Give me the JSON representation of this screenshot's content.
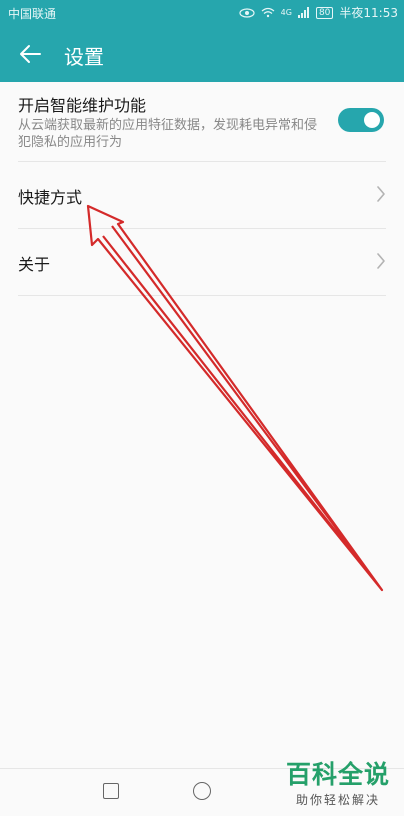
{
  "status_bar": {
    "carrier": "中国联通",
    "signal_type": "4G",
    "battery": "80",
    "time": "半夜11:53"
  },
  "app_bar": {
    "back_icon": "arrow-left-icon",
    "title": "设置"
  },
  "settings": {
    "smart_maintenance": {
      "title": "开启智能维护功能",
      "description": "从云端获取最新的应用特征数据，发现耗电异常和侵犯隐私的应用行为",
      "enabled": true
    },
    "items": [
      {
        "label": "快捷方式",
        "icon": "chevron-right-icon"
      },
      {
        "label": "关于",
        "icon": "chevron-right-icon"
      }
    ]
  },
  "nav_bar": {
    "recent_icon": "square-icon",
    "home_icon": "circle-icon"
  },
  "watermark": {
    "main": "百科全说",
    "sub": "助你轻松解决"
  },
  "colors": {
    "accent": "#26a6ad",
    "annotation": "#d42a2a",
    "watermark": "#25a06a"
  }
}
